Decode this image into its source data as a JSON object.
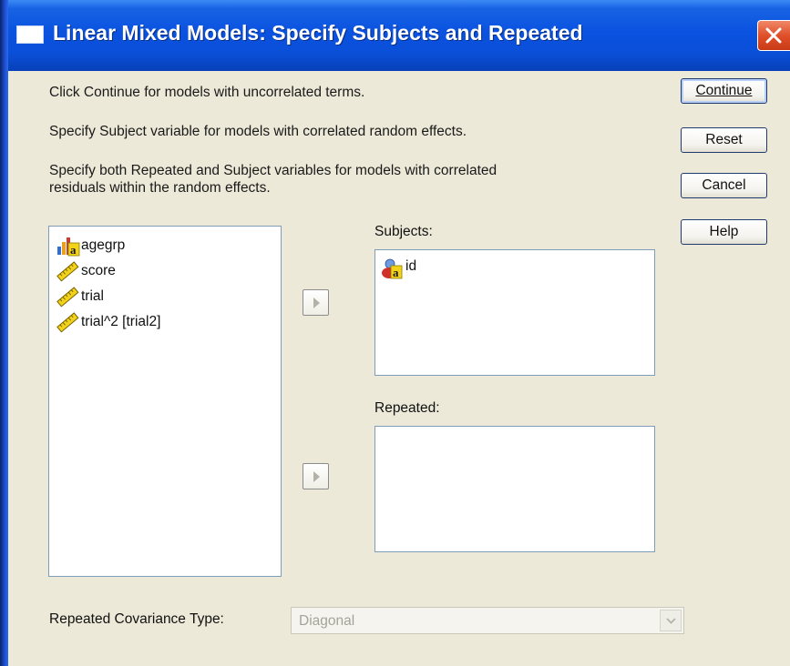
{
  "window": {
    "title": "Linear Mixed Models: Specify Subjects and Repeated"
  },
  "instructions": [
    "Click Continue for models with uncorrelated terms.",
    "Specify Subject variable for models with correlated random effects.",
    "Specify both Repeated and Subject variables for models with correlated",
    "residuals within the random effects."
  ],
  "buttons": {
    "continue": "Continue",
    "reset": "Reset",
    "cancel": "Cancel",
    "help": "Help"
  },
  "variables": [
    {
      "label": "agegrp",
      "icon": "nominal-string-icon"
    },
    {
      "label": "score",
      "icon": "scale-ruler-icon"
    },
    {
      "label": "trial",
      "icon": "scale-ruler-icon"
    },
    {
      "label": "trial^2 [trial2]",
      "icon": "scale-ruler-icon"
    }
  ],
  "subjects": {
    "label": "Subjects:",
    "items": [
      {
        "label": "id",
        "icon": "nominal-person-icon"
      }
    ]
  },
  "repeated": {
    "label": "Repeated:",
    "items": []
  },
  "covariance": {
    "label": "Repeated Covariance Type:",
    "value": "Diagonal",
    "enabled": false
  },
  "colors": {
    "titlebar": "#0a52e0",
    "dialog_bg": "#ece9d8",
    "close_button": "#e0502a"
  }
}
